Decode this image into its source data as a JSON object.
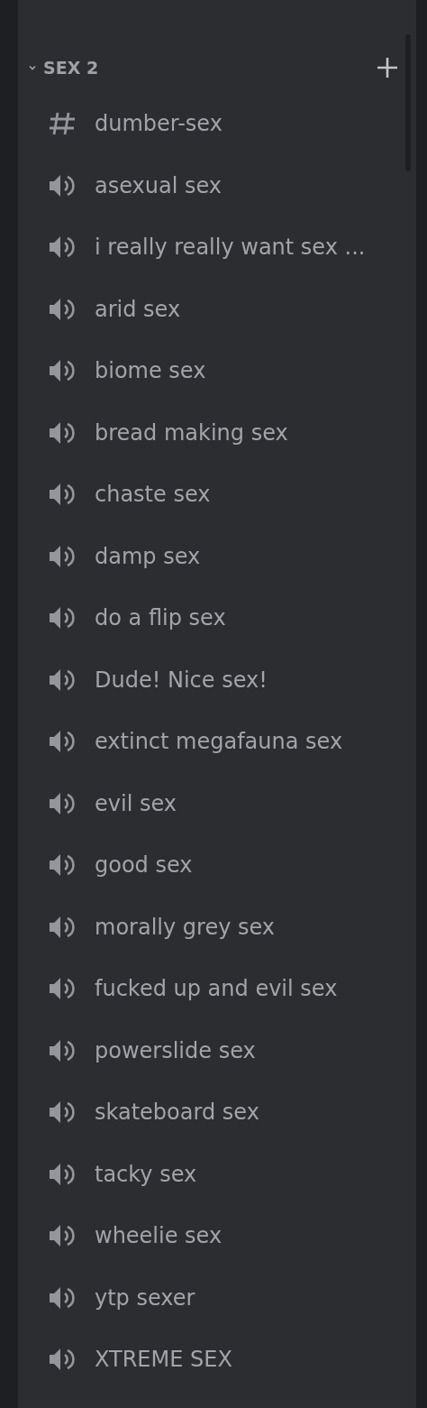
{
  "category": {
    "name": "SEX 2",
    "expanded": true
  },
  "channels": [
    {
      "kind": "text",
      "name": "dumber-sex"
    },
    {
      "kind": "voice",
      "name": "asexual sex"
    },
    {
      "kind": "voice",
      "name": "i really really want sex ..."
    },
    {
      "kind": "voice",
      "name": "arid sex"
    },
    {
      "kind": "voice",
      "name": "biome sex"
    },
    {
      "kind": "voice",
      "name": "bread making sex"
    },
    {
      "kind": "voice",
      "name": "chaste sex"
    },
    {
      "kind": "voice",
      "name": "damp sex"
    },
    {
      "kind": "voice",
      "name": "do a flip sex"
    },
    {
      "kind": "voice",
      "name": "Dude! Nice sex!"
    },
    {
      "kind": "voice",
      "name": "extinct megafauna sex"
    },
    {
      "kind": "voice",
      "name": "evil sex"
    },
    {
      "kind": "voice",
      "name": "good sex"
    },
    {
      "kind": "voice",
      "name": "morally grey sex"
    },
    {
      "kind": "voice",
      "name": "fucked up and evil sex"
    },
    {
      "kind": "voice",
      "name": "powerslide sex"
    },
    {
      "kind": "voice",
      "name": "skateboard sex"
    },
    {
      "kind": "voice",
      "name": "tacky sex"
    },
    {
      "kind": "voice",
      "name": "wheelie sex"
    },
    {
      "kind": "voice",
      "name": "ytp sexer"
    },
    {
      "kind": "voice",
      "name": "XTREME SEX"
    }
  ]
}
